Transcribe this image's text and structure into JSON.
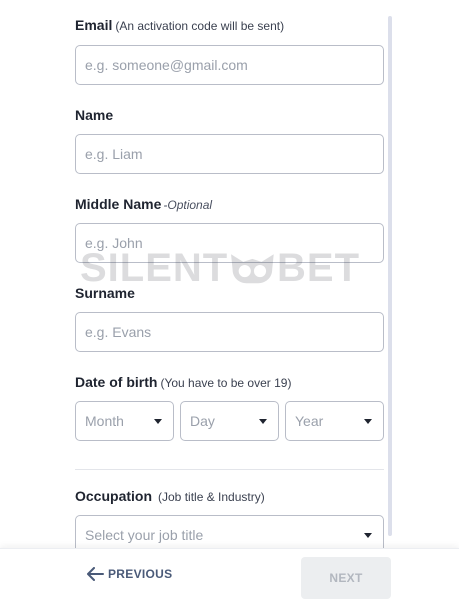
{
  "form": {
    "email": {
      "label": "Email",
      "note": "(An activation code will be sent)",
      "placeholder": "e.g. someone@gmail.com"
    },
    "name": {
      "label": "Name",
      "placeholder": "e.g. Liam"
    },
    "middle_name": {
      "label": "Middle Name",
      "optional": "-Optional",
      "placeholder": "e.g. John"
    },
    "surname": {
      "label": "Surname",
      "placeholder": "e.g. Evans"
    },
    "dob": {
      "label": "Date of birth",
      "note": "(You have to be over 19)",
      "month": "Month",
      "day": "Day",
      "year": "Year"
    },
    "occupation": {
      "label": "Occupation",
      "note": "(Job title & Industry)",
      "placeholder": "Select your job title"
    }
  },
  "watermark": {
    "text_left": "SILENT",
    "text_right": "BET"
  },
  "footer": {
    "previous_label": "PREVIOUS",
    "next_label": "NEXT"
  },
  "icons": {
    "previous": "arrow-left-icon",
    "dropdown": "chevron-down-icon",
    "watermark": "owl-logo-icon"
  }
}
